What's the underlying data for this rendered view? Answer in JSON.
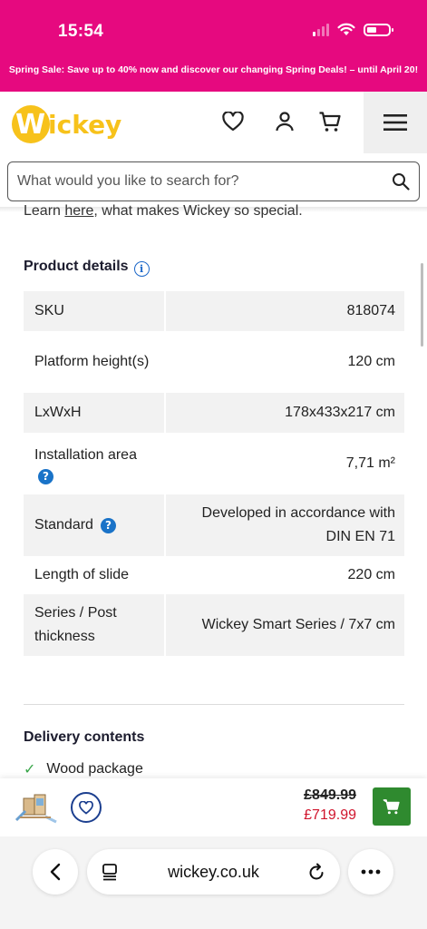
{
  "status_bar": {
    "time": "15:54"
  },
  "promo": {
    "text": "Spring Sale: Save up to 40% now and discover our changing Spring Deals! – until April 20!"
  },
  "header": {
    "logo_text": "Wickey",
    "search_placeholder": "What would you like to search for?"
  },
  "intro": {
    "prefix": "Learn ",
    "link": "here",
    "suffix": ", what makes Wickey so special."
  },
  "product_details": {
    "title": "Product details",
    "rows": [
      {
        "label": "SKU",
        "value": "818074"
      },
      {
        "label": "Platform height(s)",
        "value": "120 cm"
      },
      {
        "label": "LxWxH",
        "value": "178x433x217 cm"
      },
      {
        "label": "Installation area",
        "value": "7,71 m²"
      },
      {
        "label": "Standard",
        "value": "Developed in accordance with DIN EN 71"
      },
      {
        "label": "Length of slide",
        "value": "220 cm"
      },
      {
        "label": "Series / Post thickness",
        "value": "Wickey Smart Series / 7x7 cm"
      }
    ]
  },
  "delivery": {
    "title": "Delivery contents",
    "items": [
      "Wood package"
    ]
  },
  "buybar": {
    "old_price": "£849.99",
    "new_price": "£719.99"
  },
  "browser": {
    "url": "wickey.co.uk"
  },
  "colors": {
    "brand_magenta": "#e6097f",
    "logo_yellow": "#f7c21b",
    "cart_green": "#2f8a2f",
    "sale_red": "#d0142c",
    "info_blue": "#1a73c8"
  },
  "icons": [
    "signal-icon",
    "wifi-icon",
    "battery-icon",
    "heart-icon",
    "user-icon",
    "cart-icon",
    "menu-icon",
    "search-icon",
    "info-icon",
    "help-icon",
    "check-icon",
    "back-icon",
    "tabs-icon",
    "reload-icon",
    "more-icon"
  ]
}
